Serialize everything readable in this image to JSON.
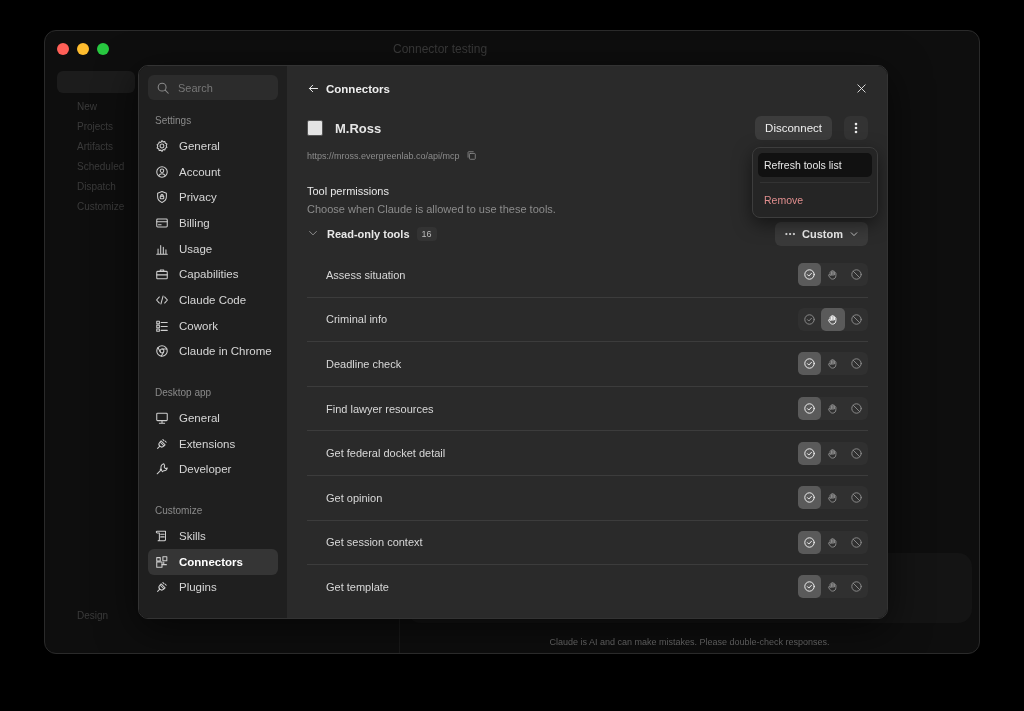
{
  "window": {
    "title": "Connector testing"
  },
  "background_sidebar": {
    "items": [
      "New",
      "Projects",
      "Artifacts",
      "Scheduled",
      "Dispatch",
      "Customize"
    ],
    "footer": "Design"
  },
  "disclaimer": "Claude is AI and can make mistakes. Please double-check responses.",
  "settings": {
    "search": {
      "placeholder": "Search"
    },
    "sections": [
      {
        "title": "Settings",
        "items": [
          {
            "label": "General",
            "selected": false
          },
          {
            "label": "Account",
            "selected": false
          },
          {
            "label": "Privacy",
            "selected": false
          },
          {
            "label": "Billing",
            "selected": false
          },
          {
            "label": "Usage",
            "selected": false
          },
          {
            "label": "Capabilities",
            "selected": false
          },
          {
            "label": "Claude Code",
            "selected": false
          },
          {
            "label": "Cowork",
            "selected": false
          },
          {
            "label": "Claude in Chrome",
            "selected": false
          }
        ]
      },
      {
        "title": "Desktop app",
        "items": [
          {
            "label": "General",
            "selected": false
          },
          {
            "label": "Extensions",
            "selected": false
          },
          {
            "label": "Developer",
            "selected": false
          }
        ]
      },
      {
        "title": "Customize",
        "items": [
          {
            "label": "Skills",
            "selected": false
          },
          {
            "label": "Connectors",
            "selected": true
          },
          {
            "label": "Plugins",
            "selected": false
          }
        ]
      }
    ]
  },
  "connector": {
    "back_label": "Connectors",
    "name": "M.Ross",
    "url": "https://mross.evergreenlab.co/api/mcp",
    "disconnect": "Disconnect",
    "menu": [
      {
        "label": "Refresh tools list",
        "kind": "normal",
        "selected": true
      },
      {
        "label": "Remove",
        "kind": "danger",
        "selected": false
      }
    ],
    "permissions_title": "Tool permissions",
    "permissions_description": "Choose when Claude is allowed to use these tools.",
    "group": {
      "label": "Read-only tools",
      "count": "16",
      "expanded": true,
      "mode": "Custom"
    },
    "tools": [
      {
        "name": "Assess situation",
        "options": [
          {
            "kind": "allow",
            "selected": true
          },
          {
            "kind": "ask",
            "selected": false
          },
          {
            "kind": "block",
            "selected": false
          }
        ]
      },
      {
        "name": "Criminal info",
        "options": [
          {
            "kind": "allow",
            "selected": false
          },
          {
            "kind": "ask",
            "selected": true
          },
          {
            "kind": "block",
            "selected": false
          }
        ]
      },
      {
        "name": "Deadline check",
        "options": [
          {
            "kind": "allow",
            "selected": true
          },
          {
            "kind": "ask",
            "selected": false
          },
          {
            "kind": "block",
            "selected": false
          }
        ]
      },
      {
        "name": "Find lawyer resources",
        "options": [
          {
            "kind": "allow",
            "selected": true
          },
          {
            "kind": "ask",
            "selected": false
          },
          {
            "kind": "block",
            "selected": false
          }
        ]
      },
      {
        "name": "Get federal docket detail",
        "options": [
          {
            "kind": "allow",
            "selected": true
          },
          {
            "kind": "ask",
            "selected": false
          },
          {
            "kind": "block",
            "selected": false
          }
        ]
      },
      {
        "name": "Get opinion",
        "options": [
          {
            "kind": "allow",
            "selected": true
          },
          {
            "kind": "ask",
            "selected": false
          },
          {
            "kind": "block",
            "selected": false
          }
        ]
      },
      {
        "name": "Get session context",
        "options": [
          {
            "kind": "allow",
            "selected": true
          },
          {
            "kind": "ask",
            "selected": false
          },
          {
            "kind": "block",
            "selected": false
          }
        ]
      },
      {
        "name": "Get template",
        "options": [
          {
            "kind": "allow",
            "selected": true
          },
          {
            "kind": "ask",
            "selected": false
          },
          {
            "kind": "block",
            "selected": false
          }
        ]
      }
    ]
  }
}
